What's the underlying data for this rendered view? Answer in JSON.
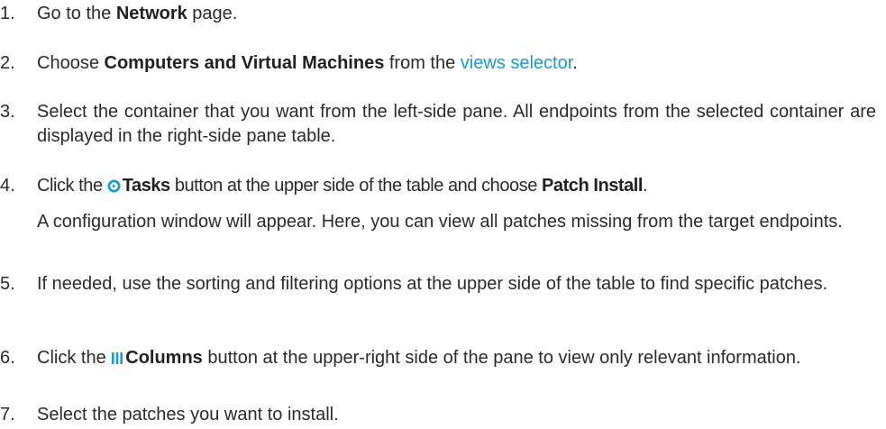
{
  "steps": [
    {
      "number": "1.",
      "pre": "Go to the ",
      "bold": "Network",
      "post": " page."
    },
    {
      "number": "2.",
      "pre": "Choose ",
      "bold": "Computers and Virtual Machines",
      "mid": " from the ",
      "link": "views selector",
      "post": "."
    },
    {
      "number": "3.",
      "text": "Select the container that you want from the left-side pane. All endpoints from the selected container are displayed in the right-side pane table."
    },
    {
      "number": "4.",
      "pre": "Click the ",
      "icon": "tasks-icon",
      "bold": "Tasks",
      "mid": " button at the upper side of the table and choose ",
      "bold2": "Patch Install",
      "post": ".",
      "note": "A configuration window will appear. Here, you can view all patches missing from the target endpoints."
    },
    {
      "number": "5.",
      "text": "If needed, use the sorting and filtering options at the upper side of the table to find specific patches."
    },
    {
      "number": "6.",
      "pre": "Click the ",
      "icon": "columns-icon",
      "bold": "Columns",
      "post": " button at the upper-right side of the pane to view only relevant information."
    },
    {
      "number": "7.",
      "text": "Select the patches you want to install."
    }
  ],
  "colors": {
    "text": "#2b2b2b",
    "link": "#1a9bd7",
    "icon": "#1a9bd7"
  }
}
